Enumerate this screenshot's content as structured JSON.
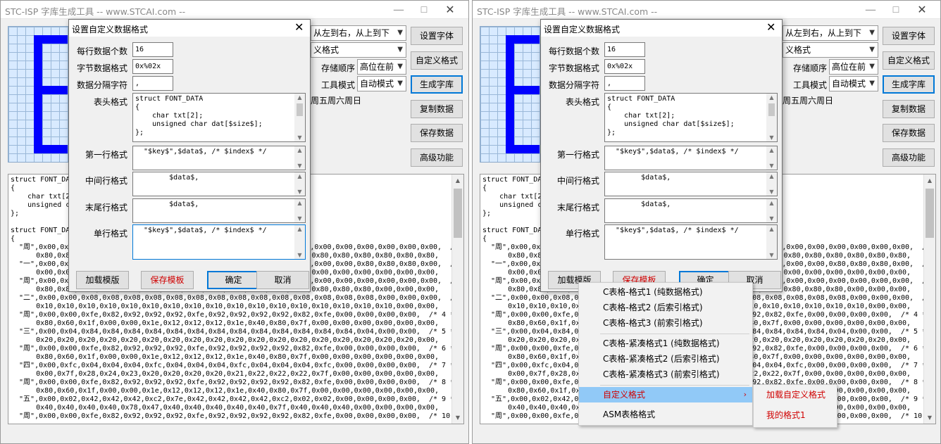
{
  "app": {
    "title": "STC-ISP 字库生成工具 -- www.STCAI.com --",
    "minimize_glyph": "—",
    "maximize_glyph": "☐",
    "close_glyph": "✕"
  },
  "toolbar": {
    "scan_direction": "从左到右，从上到下",
    "format_select": "义格式",
    "storage_order_label": "存储顺序",
    "storage_order": "高位在前",
    "tool_mode_label": "工具模式",
    "tool_mode": "自动模式",
    "sample_text": "周五周六周日",
    "buttons": {
      "set_font": "设置字体",
      "custom_format": "自定义格式",
      "generate": "生成字库",
      "copy_data": "复制数据",
      "save_data": "保存数据",
      "advanced": "高级功能"
    }
  },
  "output": {
    "lines": [
      "struct FONT_DATA",
      "{",
      "    char txt[2];",
      "    unsigned char dat[$size$];",
      "};",
      "",
      "struct FONT_DATA",
      "{",
      "  \"周\",0x00,0x00,0x00,0x00,0x00,0x00,0x00,0x00,0x00,0x00,0x00,0x00,0x00,0x00,0x00,0x00,0x00,0x00,0x00,  /* 0 */",
      "      0x80,0x80,0x80,0x80,0x80,0x80,0x80,0x80,0x80,0x80,0x80,0x80,0x80,0x80,0x80,0x80,0x80,0x80,0x80,",
      "  \"一\",0x00,0x00,0x00,0x00,0x00,0x00,0x00,0x00,0x00,0x00,0x00,0x00,0x00,0x00,0x00,0x80,0x80,0x80,0x00,  /* 1 */",
      "      0x00,0x00,0x00,0x00,0x00,0x00,0x00,0x00,0x00,0x00,0x00,0x00,0x00,0x00,0x00,0x00,0x00,0x00,0x00,",
      "  \"周\",0x00,0x00,0x00,0x00,0x00,0x00,0x00,0x00,0x00,0x00,0x00,0x00,0x00,0x00,0x00,0x00,0x00,0x00,0x00,  /* 2 */",
      "      0x80,0x80,0x80,0x80,0x80,0x80,0x80,0x80,0x80,0x80,0x80,0x80,0x80,0x80,0x80,0x80,0x00,0x00,0x00,",
      "  \"二\",0x00,0x00,0x08,0x08,0x08,0x08,0x08,0x08,0x08,0x08,0x08,0x08,0x08,0x08,0x08,0x08,0x00,0x00,0x00,  /* 3 */",
      "      0x10,0x10,0x10,0x10,0x10,0x10,0x10,0x10,0x10,0x10,0x10,0x10,0x10,0x10,0x10,0x10,0x10,0x00,0x00,",
      "  \"周\",0x00,0x00,0xfe,0x82,0x92,0x92,0x92,0xfe,0x92,0x92,0x92,0x92,0x82,0xfe,0x00,0x00,0x00,0x00,  /* 4 */",
      "      0x80,0x60,0x1f,0x00,0x00,0x1e,0x12,0x12,0x12,0x1e,0x40,0x80,0x7f,0x00,0x00,0x00,0x00,0x00,0x00,",
      "  \"三\",0x00,0x04,0x84,0x84,0x84,0x84,0x84,0x84,0x84,0x84,0x84,0x84,0x84,0x84,0x84,0x04,0x00,0x00,  /* 5 */",
      "      0x20,0x20,0x20,0x20,0x20,0x20,0x20,0x20,0x20,0x20,0x20,0x20,0x20,0x20,0x20,0x20,0x20,0x20,0x00,",
      "  \"周\",0x00,0x00,0xfe,0x82,0x92,0x92,0x92,0xfe,0x92,0x92,0x92,0x92,0x82,0xfe,0x00,0x00,0x00,0x00,  /* 6 */",
      "      0x80,0x60,0x1f,0x00,0x00,0x1e,0x12,0x12,0x12,0x1e,0x40,0x80,0x7f,0x00,0x00,0x00,0x00,0x00,0x00,",
      "  \"四\",0x00,0xfc,0x04,0x04,0x04,0xfc,0x04,0x04,0x04,0xfc,0x04,0x04,0x04,0xfc,0x00,0x00,0x00,0x00,  /* 7 */",
      "      0x00,0x7f,0x28,0x24,0x23,0x20,0x20,0x20,0x20,0x21,0x22,0x22,0x22,0x7f,0x00,0x00,0x00,0x00,0x00,",
      "  \"周\",0x00,0x00,0xfe,0x82,0x92,0x92,0x92,0xfe,0x92,0x92,0x92,0x92,0x82,0xfe,0x00,0x00,0x00,0x00,  /* 8 */",
      "      0x80,0x60,0x1f,0x00,0x00,0x1e,0x12,0x12,0x12,0x1e,0x40,0x80,0x7f,0x00,0x00,0x00,0x00,0x00,0x00,",
      "  \"五\",0x00,0x02,0x42,0x42,0x42,0xc2,0x7e,0x42,0x42,0x42,0x42,0xc2,0x02,0x02,0x00,0x00,0x00,0x00,  /* 9 */",
      "      0x40,0x40,0x40,0x40,0x78,0x47,0x40,0x40,0x40,0x40,0x40,0x7f,0x40,0x40,0x40,0x00,0x00,0x00,0x00,",
      "  \"周\",0x00,0x00,0xfe,0x82,0x92,0x92,0x92,0xfe,0x92,0x92,0x92,0x92,0x82,0xfe,0x00,0x00,0x00,0x00,  /* 10 */"
    ]
  },
  "dialog": {
    "title": "设置自定义数据格式",
    "close_glyph": "✕",
    "fields": {
      "per_line_label": "每行数据个数",
      "per_line_value": "16",
      "byte_format_label": "字节数据格式",
      "byte_format_value": "0x%02x",
      "separator_label": "数据分隔字符",
      "separator_value": ",",
      "header_label": "表头格式",
      "header_value": "struct FONT_DATA\n{\n    char txt[2];\n    unsigned char dat[$size$];\n};",
      "first_line_label": "第一行格式",
      "first_line_value": "  \"$key$\",$data$, /* $index$ */",
      "middle_line_label": "中间行格式",
      "middle_line_value": "        $data$,",
      "last_line_label": "末尾行格式",
      "last_line_value": "        $data$,",
      "single_line_label": "单行格式",
      "single_line_value": "  \"$key$\",$data$, /* $index$ */"
    },
    "buttons": {
      "load_template": "加载模版",
      "save_template": "保存模板",
      "ok": "确定",
      "cancel": "取消"
    }
  },
  "menu": {
    "items": [
      "C表格-格式1 (纯数据格式)",
      "C表格-格式2 (后索引格式)",
      "C表格-格式3 (前索引格式)",
      "C表格-紧凑格式1 (纯数据格式)",
      "C表格-紧凑格式2 (后索引格式)",
      "C表格-紧凑格式3 (前索引格式)",
      "自定义格式",
      "ASM表格格式"
    ],
    "submenu_arrow": "›",
    "submenu": [
      "加载自定义格式",
      "我的格式1"
    ]
  },
  "colors": {
    "pixel_on": "#0000ff",
    "accent": "#0078d7",
    "danger_text": "#d00000",
    "menu_highlight": "#91c9f7"
  },
  "icons": {
    "minimize": "minimize-icon",
    "maximize": "maximize-icon",
    "close": "close-icon",
    "dropdown": "chevron-down-icon",
    "scroll_up": "scroll-up-arrow-icon",
    "scroll_down": "scroll-down-arrow-icon",
    "submenu": "chevron-right-icon"
  }
}
